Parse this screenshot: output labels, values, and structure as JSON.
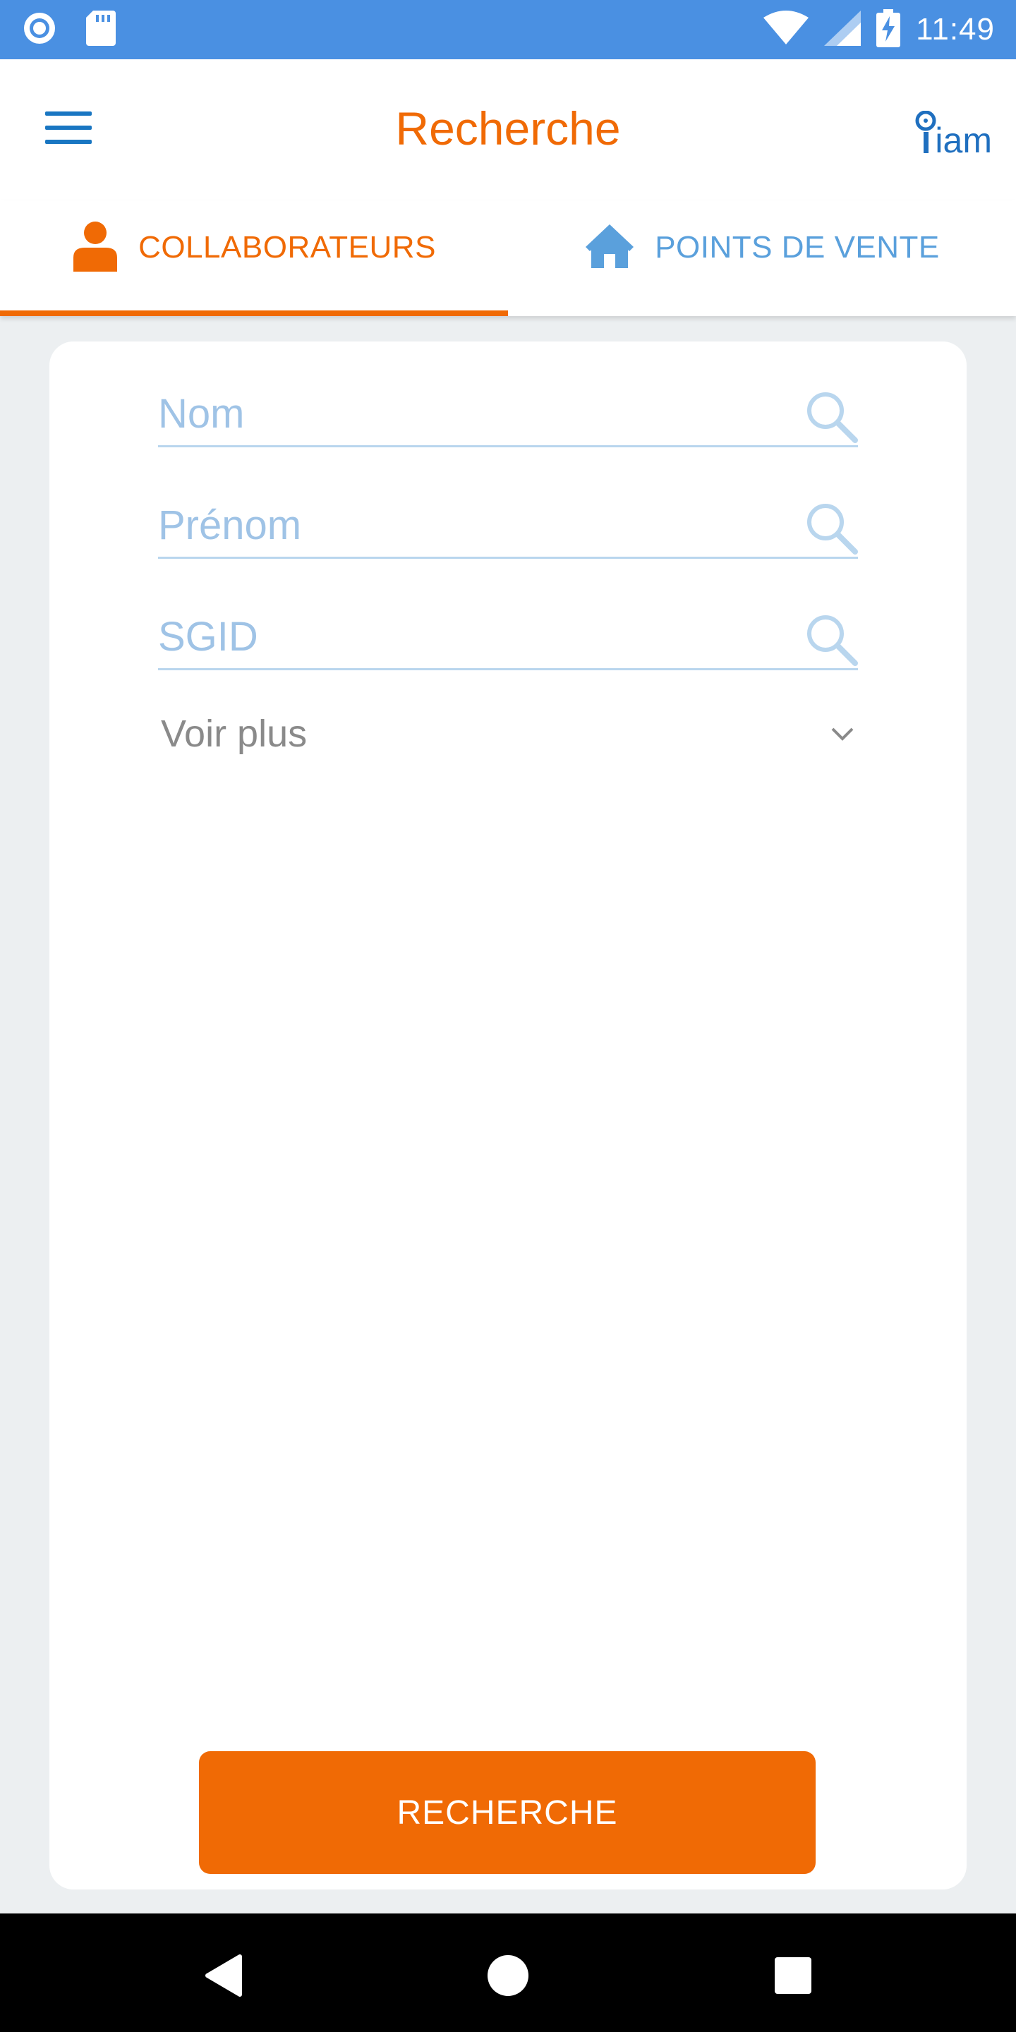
{
  "status_bar": {
    "time": "11:49",
    "icons": [
      "record-icon",
      "sd-card-icon",
      "wifi-icon",
      "signal-icon",
      "battery-charging-icon"
    ]
  },
  "app_bar": {
    "title": "Recherche",
    "menu_icon": "hamburger-menu-icon",
    "logo_text": "iam"
  },
  "tabs": [
    {
      "label": "COLLABORATEURS",
      "icon": "person-icon",
      "active": true
    },
    {
      "label": "POINTS DE VENTE",
      "icon": "home-icon",
      "active": false
    }
  ],
  "form": {
    "fields": [
      {
        "placeholder": "Nom",
        "value": ""
      },
      {
        "placeholder": "Prénom",
        "value": ""
      },
      {
        "placeholder": "SGID",
        "value": ""
      }
    ],
    "more_label": "Voir plus",
    "submit_label": "RECHERCHE"
  },
  "nav_bar": {
    "icons": [
      "back-icon",
      "home-circle-icon",
      "recents-icon"
    ]
  },
  "colors": {
    "status_bar": "#4a90e2",
    "accent": "#f06a05",
    "secondary": "#5aa0dc",
    "background": "#eceff1",
    "logo": "#1f6fbf"
  }
}
